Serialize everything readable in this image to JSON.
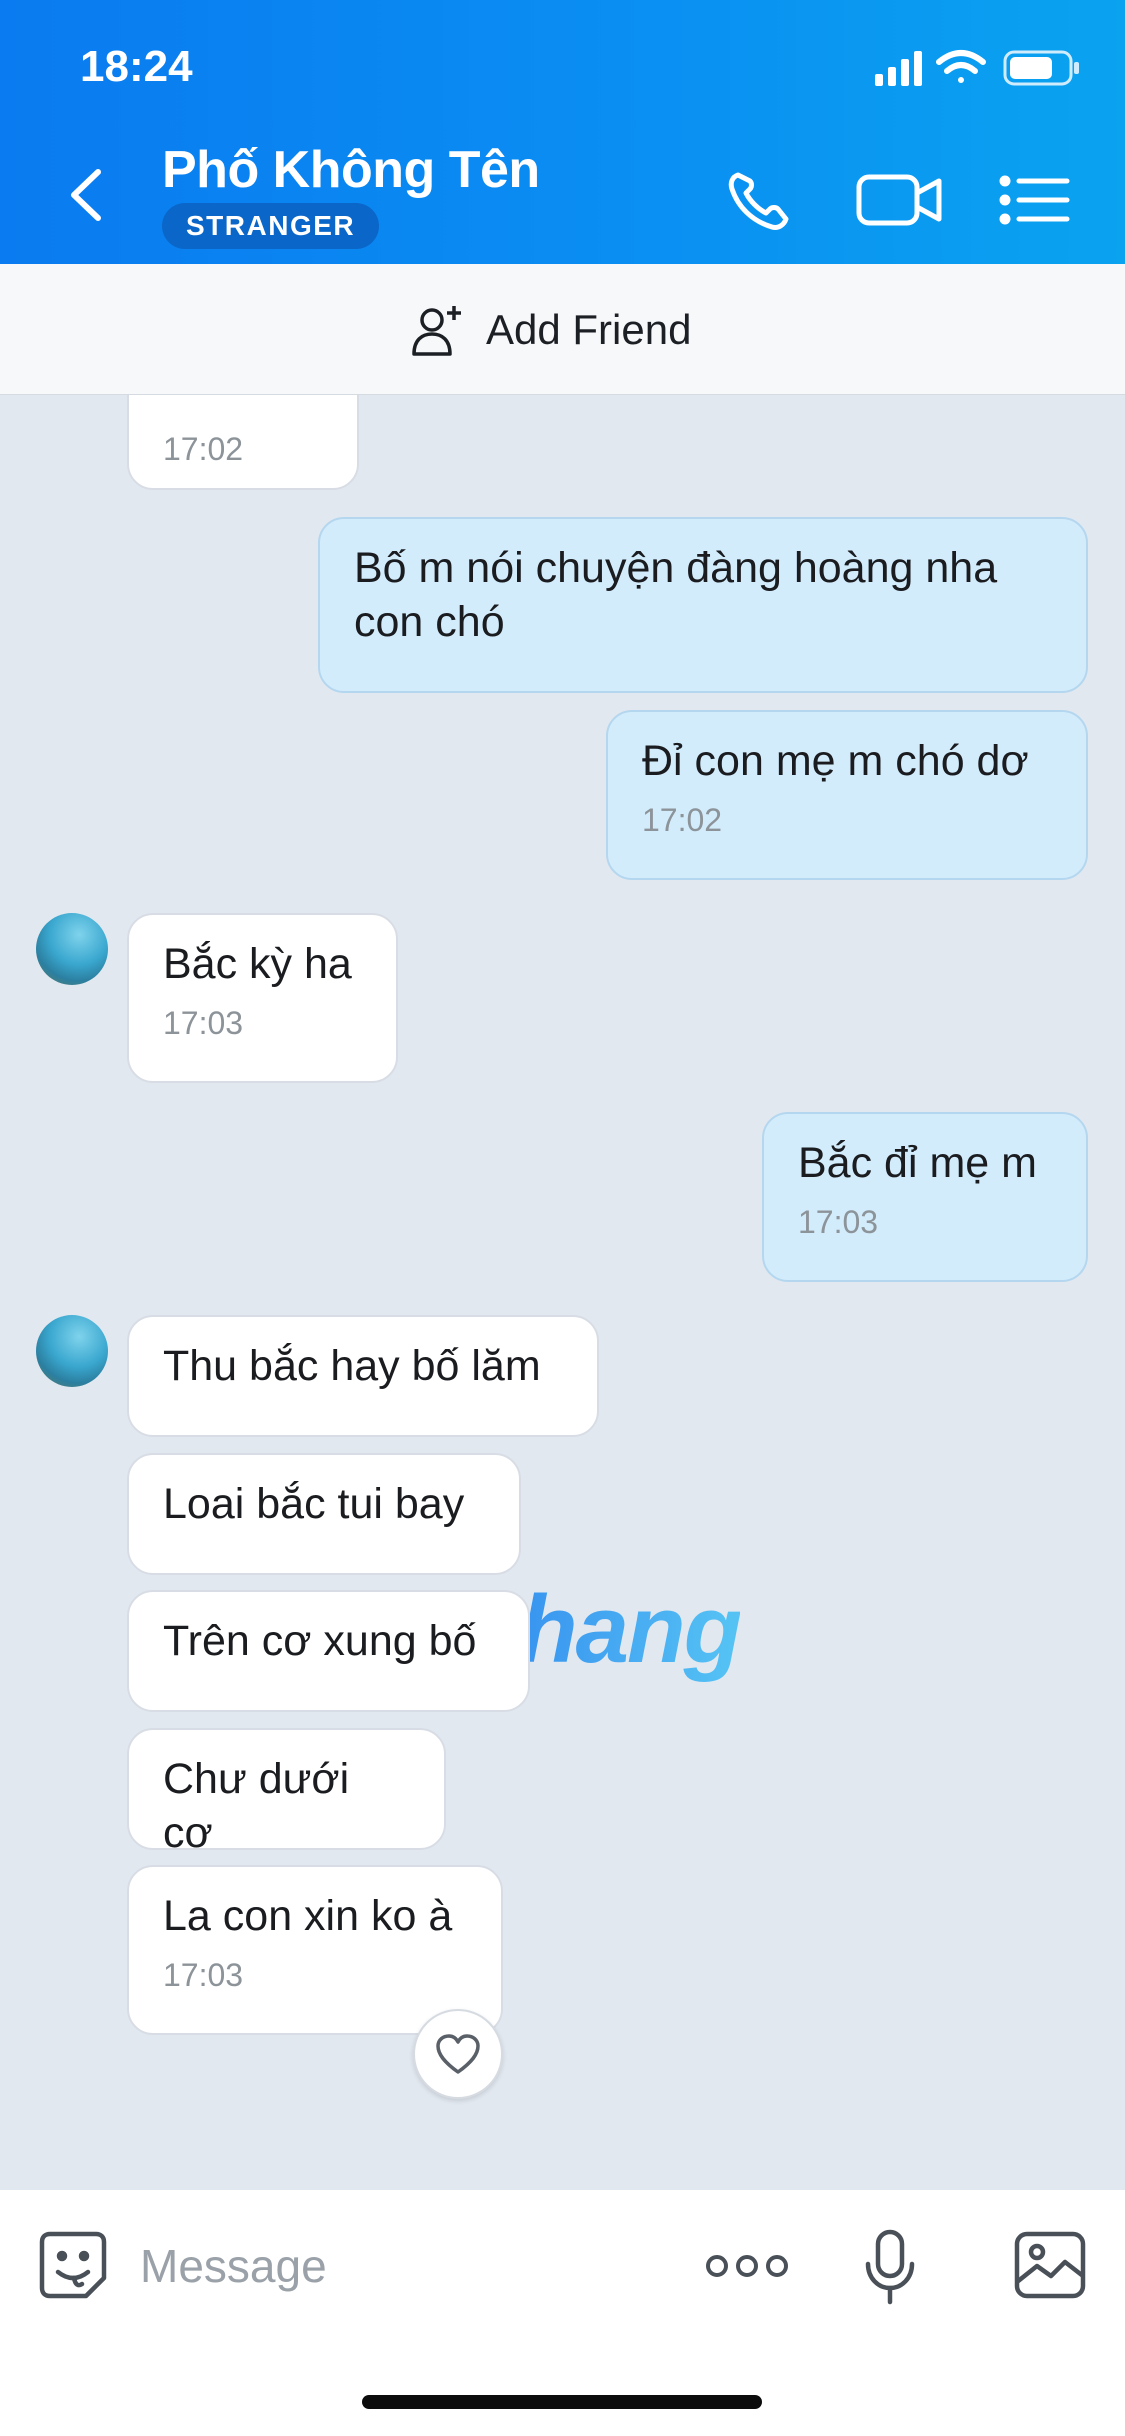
{
  "status_bar": {
    "time": "18:24"
  },
  "header": {
    "contact_name": "Phố Không Tên",
    "badge": "STRANGER",
    "icons": [
      "back-icon",
      "phone-icon",
      "video-icon",
      "list-menu-icon"
    ]
  },
  "add_friend": {
    "label": "Add Friend",
    "icon": "add-person-icon"
  },
  "messages": [
    {
      "side": "in",
      "text": "",
      "time": "17:02"
    },
    {
      "side": "out",
      "text": "Bố m nói chuyện đàng hoàng nha con chó",
      "time": ""
    },
    {
      "side": "out",
      "text": "Đỉ con mẹ m chó dơ",
      "time": "17:02"
    },
    {
      "side": "in",
      "text": "Bắc kỳ ha",
      "time": "17:03"
    },
    {
      "side": "out",
      "text": "Bắc đỉ mẹ m",
      "time": "17:03"
    },
    {
      "side": "in",
      "text": "Thu bắc hay bố lăm",
      "time": ""
    },
    {
      "side": "in",
      "text": "Loai bắc tui bay",
      "time": ""
    },
    {
      "side": "in",
      "text": "Trên cơ xung bố",
      "time": ""
    },
    {
      "side": "in",
      "text": "Chư dưới cơ",
      "time": ""
    },
    {
      "side": "in",
      "text": "La con xin ko à",
      "time": "17:03"
    }
  ],
  "watermark": "Rphang",
  "input_bar": {
    "placeholder": "Message",
    "icons": [
      "sticker-icon",
      "more-icon",
      "microphone-icon",
      "image-icon"
    ]
  },
  "colors": {
    "header_start": "#0a7bf0",
    "header_end": "#0aa3f0",
    "badge": "#0a66c8",
    "outgoing_bubble": "#d3ecfc",
    "incoming_bubble": "#ffffff",
    "chat_background": "#e2e8f0"
  }
}
